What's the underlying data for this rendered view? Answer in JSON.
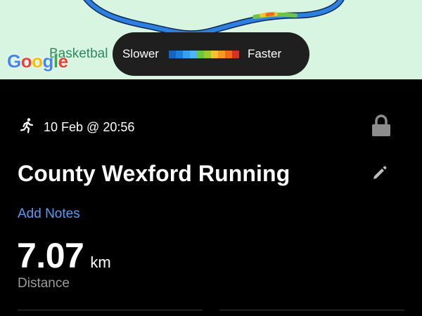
{
  "map": {
    "poi_label": "Basketbal",
    "google_letters": [
      {
        "ch": "G",
        "color": "#4285F4"
      },
      {
        "ch": "o",
        "color": "#EA4335"
      },
      {
        "ch": "o",
        "color": "#FBBC05"
      },
      {
        "ch": "g",
        "color": "#4285F4"
      },
      {
        "ch": "l",
        "color": "#34A853"
      },
      {
        "ch": "e",
        "color": "#EA4335"
      }
    ],
    "pace_legend": {
      "slower_label": "Slower",
      "faster_label": "Faster",
      "colors": [
        "#1565c0",
        "#1e7fd8",
        "#3a9ef0",
        "#4db6f5",
        "#6cc644",
        "#9ccc2c",
        "#f4c430",
        "#f59b23",
        "#ee6b1e",
        "#d93025"
      ]
    }
  },
  "activity": {
    "type_icon": "running-person-icon",
    "date": "10 Feb @ 20:56",
    "lock_icon": "lock-icon",
    "title": "County Wexford Running",
    "edit_icon": "pencil-icon",
    "add_notes": "Add Notes",
    "distance_value": "7.07",
    "distance_unit": "km",
    "distance_label": "Distance"
  }
}
